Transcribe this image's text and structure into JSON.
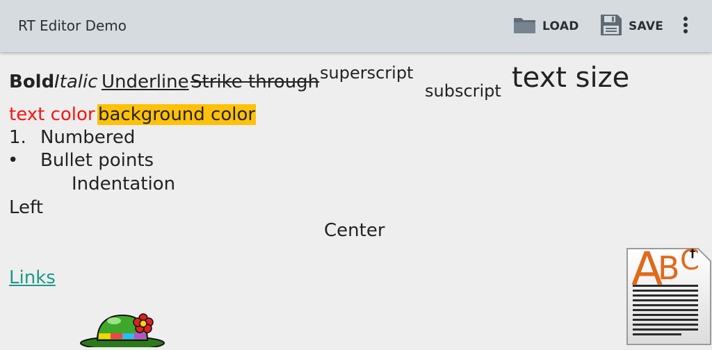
{
  "app": {
    "title": "RT Editor Demo",
    "actions": {
      "load_label": "LOAD",
      "save_label": "SAVE"
    },
    "icons": {
      "load": "folder-icon",
      "save": "floppy-disk-icon",
      "overflow": "more-vert-icon"
    }
  },
  "editor": {
    "line1": {
      "bold": "Bold",
      "italic": "Italic",
      "underline": "Underline",
      "strike": "Strike through",
      "superscript": "superscript",
      "subscript": "subscript",
      "text_size": "text size"
    },
    "line2": {
      "text_color": "text color",
      "background_color": "background color"
    },
    "numbered": {
      "marker": "1.",
      "text": "Numbered"
    },
    "bullet": {
      "marker": "•",
      "text": "Bullet points"
    },
    "indentation": "Indentation",
    "left": "Left",
    "center": "Center",
    "links": "Links",
    "colors": {
      "text_red": "#ff1010",
      "highlight": "#ffc107",
      "link": "#1a9988"
    }
  },
  "document_icon": {
    "letters": "ABC",
    "name": "rich-text-document-icon"
  }
}
